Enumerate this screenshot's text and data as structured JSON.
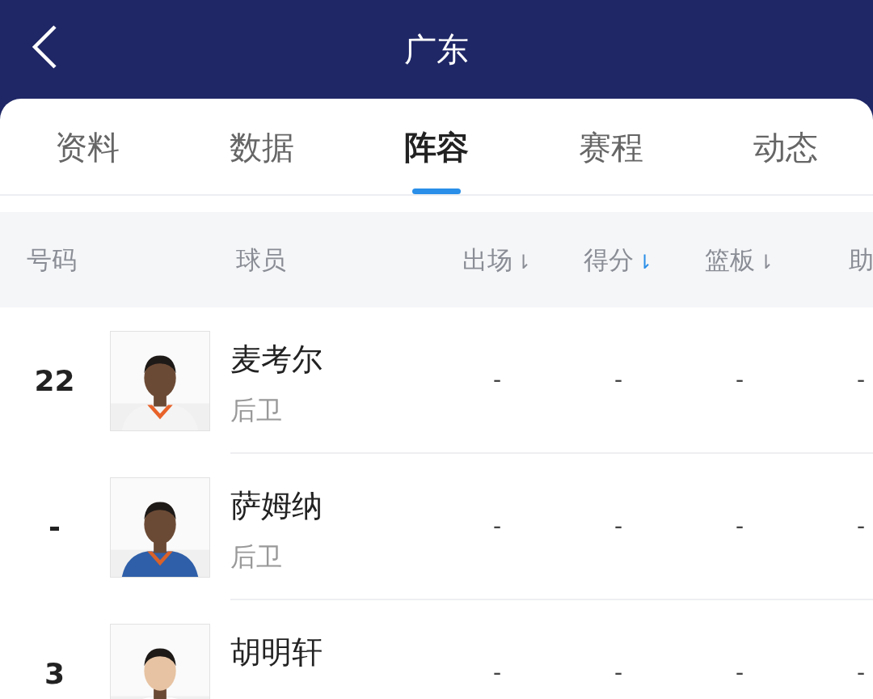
{
  "header": {
    "title": "广东"
  },
  "tabs": [
    {
      "label": "资料",
      "selected": false
    },
    {
      "label": "数据",
      "selected": false
    },
    {
      "label": "阵容",
      "selected": true
    },
    {
      "label": "赛程",
      "selected": false
    },
    {
      "label": "动态",
      "selected": false
    }
  ],
  "table": {
    "columns": [
      {
        "label": "号码"
      },
      {
        "label": "球员"
      },
      {
        "label": "出场",
        "sort": "⇂",
        "selected": false
      },
      {
        "label": "得分",
        "sort": "⇂",
        "selected": true
      },
      {
        "label": "篮板",
        "sort": "⇂",
        "selected": false
      },
      {
        "label": "助"
      }
    ],
    "rows": [
      {
        "number": "22",
        "photo": {
          "kind": "picture"
        },
        "name": "麦考尔",
        "position": "后卫",
        "stats": [
          "-",
          "-",
          "-",
          "-"
        ]
      },
      {
        "number": "-",
        "photo": {
          "kind": "picture"
        },
        "name": "萨姆纳",
        "position": "后卫",
        "stats": [
          "-",
          "-",
          "-",
          "-"
        ]
      },
      {
        "number": "3",
        "photo": {
          "kind": "picture"
        },
        "name": "胡明轩",
        "stats": [
          "-",
          "-",
          "-",
          "-"
        ]
      }
    ]
  }
}
